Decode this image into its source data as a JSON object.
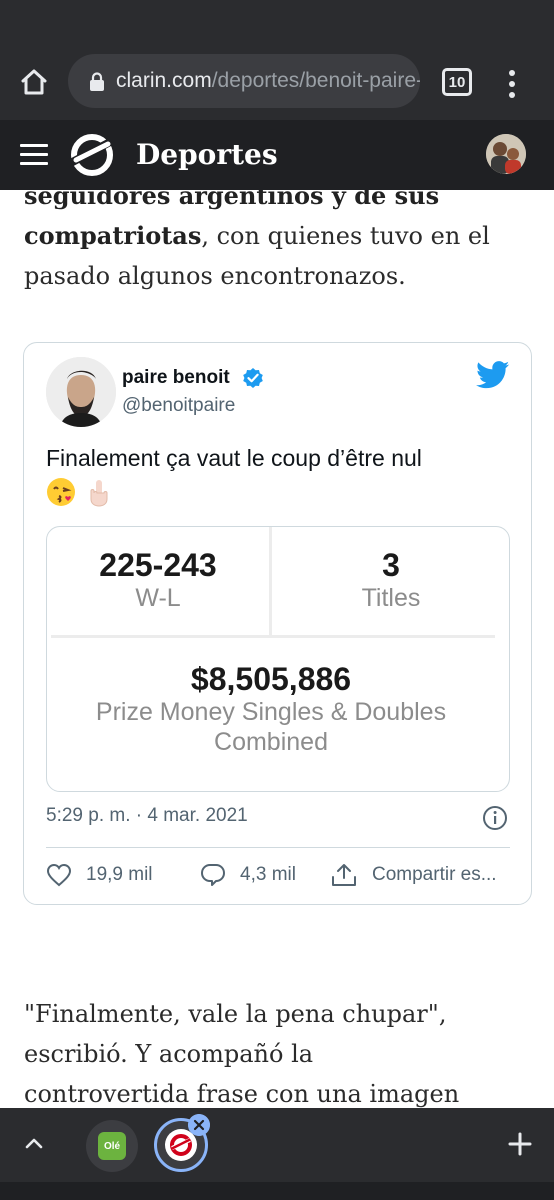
{
  "browser": {
    "url_domain": "clarin.com",
    "url_path": "/deportes/benoit-paire-",
    "tab_count": "10",
    "icons": [
      "home-icon",
      "lock-icon",
      "more-vert-icon"
    ]
  },
  "site": {
    "title": "Deportes",
    "icons": [
      "hamburger-icon",
      "clarin-logo"
    ]
  },
  "article": {
    "top_bold_1": "seguidores argentinos y de sus",
    "top_bold_2": "compatriotas",
    "top_rest_1": ", con quienes tuvo en el",
    "top_rest_2": "pasado algunos encontronazos.",
    "bottom_1": "\"Finalmente, vale la pena chupar\",",
    "bottom_2": "escribió. Y acompañó la",
    "bottom_3": "controvertida frase con una imagen"
  },
  "tweet": {
    "name": "paire benoit",
    "handle": "@benoitpaire",
    "text": "Finalement ça vaut le coup d’être nul",
    "emojis": [
      "kissing-face-emoji",
      "middle-finger-emoji"
    ],
    "stats": {
      "wl_value": "225-243",
      "wl_label": "W-L",
      "titles_value": "3",
      "titles_label": "Titles",
      "prize_value": "$8,505,886",
      "prize_label_1": "Prize Money Singles & Doubles",
      "prize_label_2": "Combined"
    },
    "timestamp": "5:29 p. m. · 4 mar. 2021",
    "likes": "19,9 mil",
    "replies": "4,3 mil",
    "share": "Compartir es...",
    "colors": {
      "verified": "#1d9bf0",
      "twitter": "#1d9bf0"
    }
  },
  "bottom_tabs": {
    "ole_label": "Olé",
    "icons": [
      "chevron-up-icon",
      "close-icon",
      "plus-icon"
    ]
  }
}
